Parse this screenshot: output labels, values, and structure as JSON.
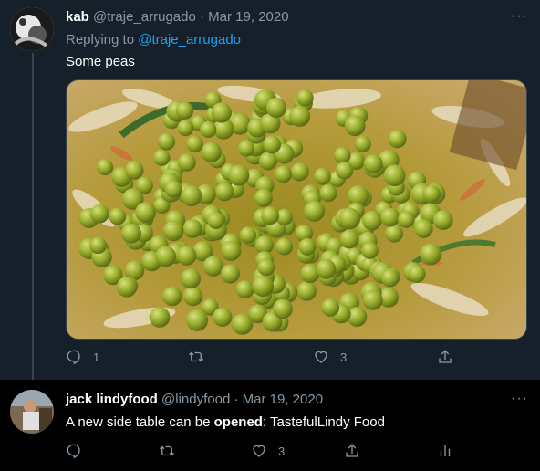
{
  "colors": {
    "background": "#15202b",
    "secondary_background": "#000000",
    "text_secondary": "#8899a6",
    "link": "#1da1f2",
    "thread_line": "#38444d"
  },
  "tweet1": {
    "name": "kab",
    "handle": "@traje_arrugado",
    "separator": "·",
    "date": "Mar 19, 2020",
    "replying_prefix": "Replying to",
    "replying_to": "@traje_arrugado",
    "text": "Some peas",
    "more_icon": "more-horizontal-icon",
    "actions": {
      "reply_count": "1",
      "retweet_count": "",
      "like_count": "3"
    }
  },
  "tweet2": {
    "name": "jack lindyfood",
    "handle": "@lindyfood",
    "separator": "·",
    "date": "Mar 19, 2020",
    "text_before": "A new side table can be ",
    "text_bold": "opened",
    "text_after": ": TastefulLindy Food",
    "more_icon": "more-horizontal-icon",
    "actions": {
      "reply_count": "",
      "retweet_count": "",
      "like_count": "3"
    }
  }
}
